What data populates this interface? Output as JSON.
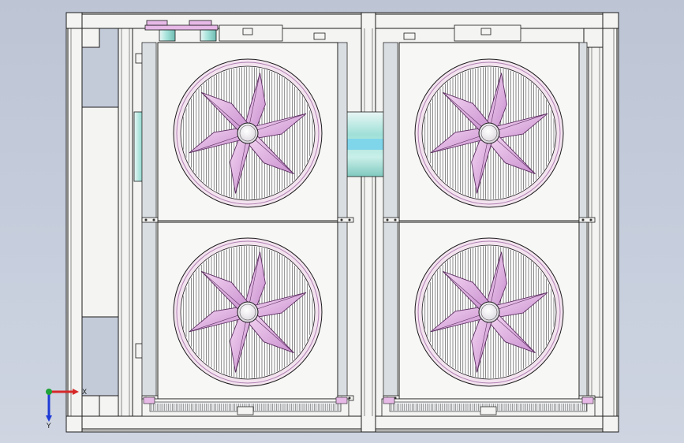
{
  "drawing": {
    "view": "front-orthographic",
    "subject": "condenser-fan-unit",
    "fan_count": 4,
    "blades_per_fan": 6
  },
  "colors": {
    "background_top": "#bdc5d5",
    "frame_fill": "#f4f4f2",
    "frame_stroke": "#1c1c1c",
    "fan_blade": "#e7b9e7",
    "fan_shroud": "#f3e3ef",
    "pipe": "#bfe7e2",
    "coil": "#9aa6b6",
    "axis_x": "#d62828",
    "axis_y": "#1f3bd6",
    "axis_z": "#1fa33a"
  },
  "axis_triad": {
    "x_label": "X",
    "y_label": "Y",
    "z_label": ""
  }
}
